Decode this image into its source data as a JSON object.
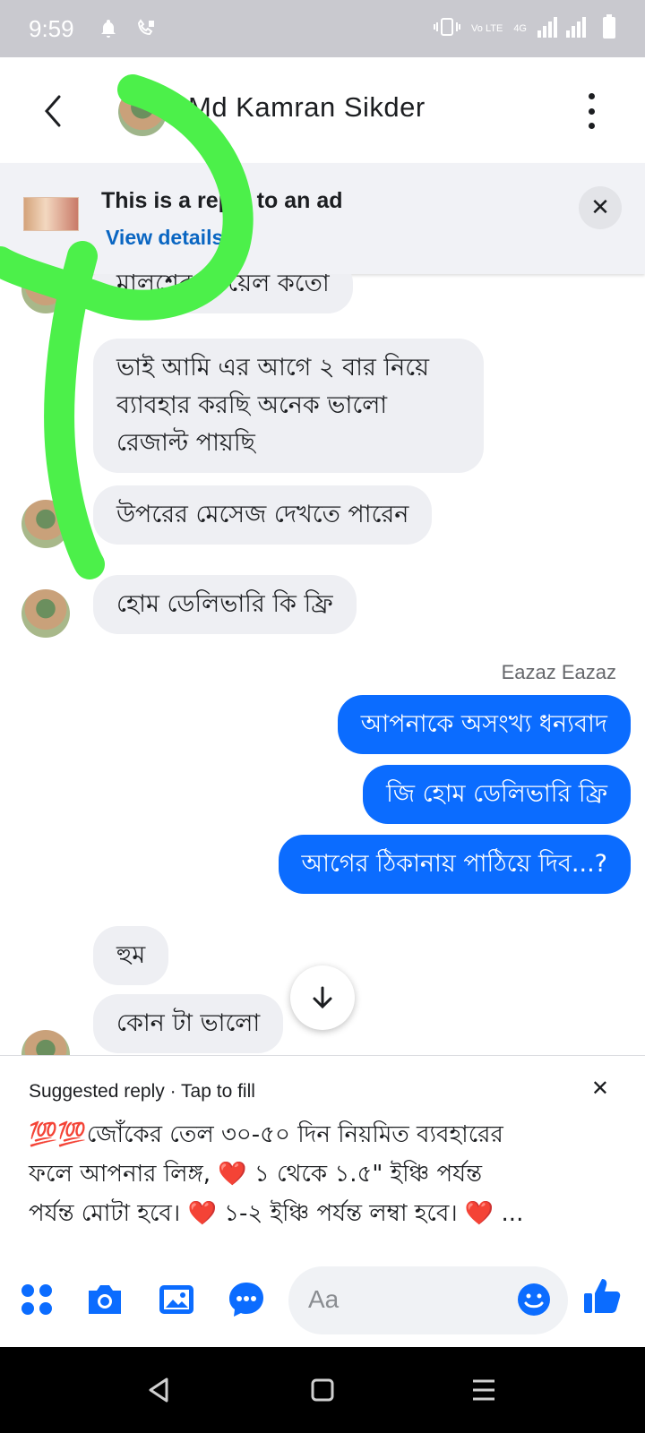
{
  "status_bar": {
    "time": "9:59",
    "network_label": "Vo LTE",
    "network_type": "4G",
    "icons": [
      "bell-icon",
      "call-forward-icon",
      "vibrate-icon",
      "signal-icon",
      "battery-icon"
    ]
  },
  "header": {
    "contact_name": "Md Kamran Sikder"
  },
  "ad_banner": {
    "title": "This is a reply to an ad",
    "link": "View details",
    "close_label": "✕"
  },
  "messages": {
    "partial_top": "মালশের তেয়েল কতো",
    "in_1": "ভাই আমি এর আগে ২ বার নিয়ে ব্যাবহার করছি অনেক ভালো রেজাল্ট পায়ছি",
    "in_1_lines": [
      "ভাই আমি এর আগে ২ বার নিয়ে",
      "ব্যাবহার করছি অনেক ভালো",
      "রেজাল্ট পায়ছি"
    ],
    "in_2": "উপরের মেসেজ দেখতে পারেন",
    "in_3": "হোম ডেলিভারি কি ফ্রি",
    "sender_name": "Eazaz Eazaz",
    "out_1": "আপনাকে অসংখ্য ধন্যবাদ",
    "out_2": "জি হোম ডেলিভারি ফ্রি",
    "out_3": "আগের ঠিকানায় পাঠিয়ে দিব...?",
    "in_4": "হুম",
    "in_5": "কোন টা ভালো"
  },
  "suggested_reply": {
    "header": "Suggested reply · Tap to fill",
    "close_label": "✕",
    "line_1": "💯💯জোঁকের তেল ৩০-৫০ দিন নিয়মিত ব্যবহারের",
    "line_2": "ফলে আপনার লিঙ্গ, ❤️ ১ থেকে ১.৫\" ইঞ্চি পর্যন্ত",
    "line_3": "পর্যন্ত মোটা হবে। ❤️ ১-২ ইঞ্চি পর্যন্ত লম্বা হবে। ❤️ ..."
  },
  "composer": {
    "placeholder": "Aa",
    "icons": [
      "apps-icon",
      "camera-icon",
      "gallery-icon",
      "chat-dots-icon",
      "emoji-icon",
      "like-icon"
    ]
  },
  "colors": {
    "accent": "#0b6cff",
    "incoming_bubble": "#eeeff3",
    "scribble": "#4cf04a"
  }
}
